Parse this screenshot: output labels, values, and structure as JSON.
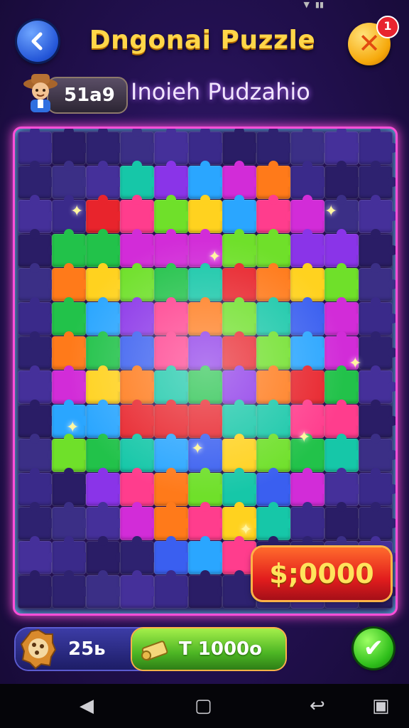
{
  "header": {
    "title": "Dngonai Puzzle",
    "close_badge": "1"
  },
  "player": {
    "score": "51a9",
    "subtitle": "Inoieh Pudzahio"
  },
  "prize": {
    "label": "$;0000"
  },
  "bottom": {
    "coins": "25ь",
    "hint_label": "T 1000o"
  },
  "icons": {
    "back": "chevron-left-icon",
    "close": "x-icon",
    "confirm": "checkmark-icon"
  },
  "colors": {
    "accent": "#ffd649",
    "board_border": "#ff4fd8",
    "prize": "#e21d1d",
    "confirm": "#2fbf1b"
  }
}
